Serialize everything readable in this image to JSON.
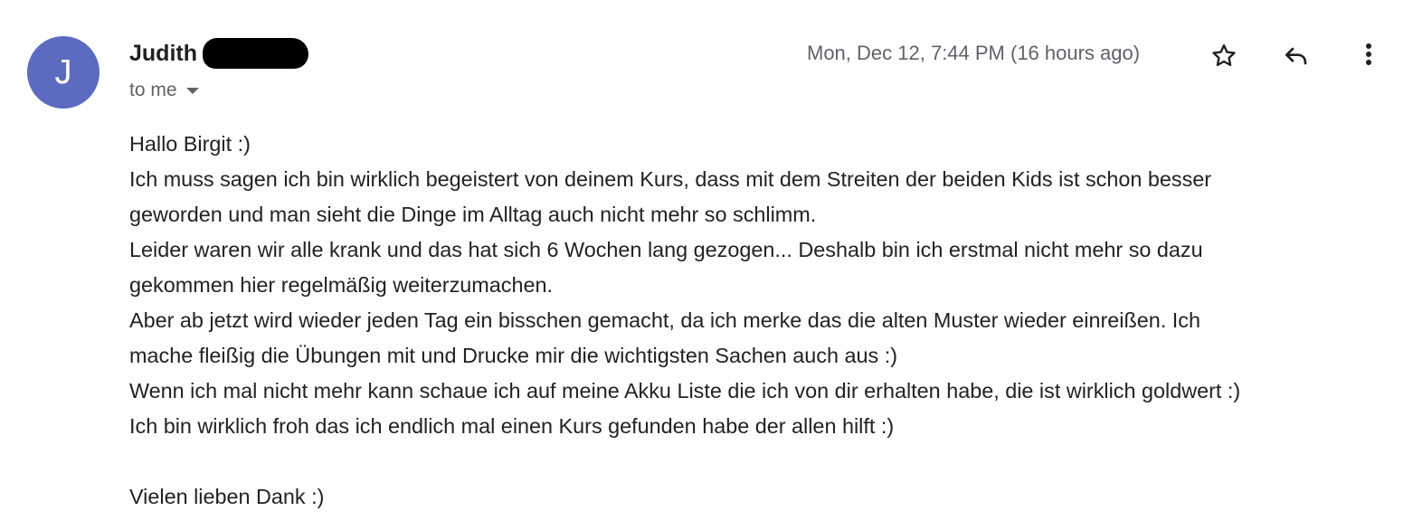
{
  "sender": {
    "avatar_letter": "J",
    "avatar_color": "#5c6bc0",
    "name": "Judith",
    "recipient_label": "to me"
  },
  "timestamp": "Mon, Dec 12, 7:44 PM (16 hours ago)",
  "actions": {
    "star_icon": "star-outline-icon",
    "reply_icon": "reply-arrow-icon",
    "more_icon": "vertical-dots-icon"
  },
  "body": {
    "lines": [
      "Hallo Birgit :)",
      "Ich muss sagen ich bin wirklich begeistert von deinem Kurs, dass mit dem Streiten der beiden Kids ist schon besser",
      "geworden und man sieht die Dinge im Alltag auch nicht mehr so schlimm.",
      "Leider waren wir alle krank und das hat sich 6 Wochen lang gezogen... Deshalb bin ich erstmal nicht mehr so dazu",
      "gekommen hier regelmäßig weiterzumachen.",
      "Aber ab jetzt wird wieder jeden Tag ein bisschen gemacht, da ich merke das die alten Muster wieder einreißen. Ich",
      "mache fleißig die Übungen mit und  Drucke mir die wichtigsten Sachen auch aus :)",
      "Wenn ich mal nicht mehr kann schaue ich auf meine Akku Liste die ich von dir erhalten habe, die ist wirklich goldwert :)",
      "Ich bin wirklich froh das ich endlich mal einen Kurs gefunden habe der allen hilft :)"
    ],
    "closing": "Vielen lieben Dank :)"
  }
}
